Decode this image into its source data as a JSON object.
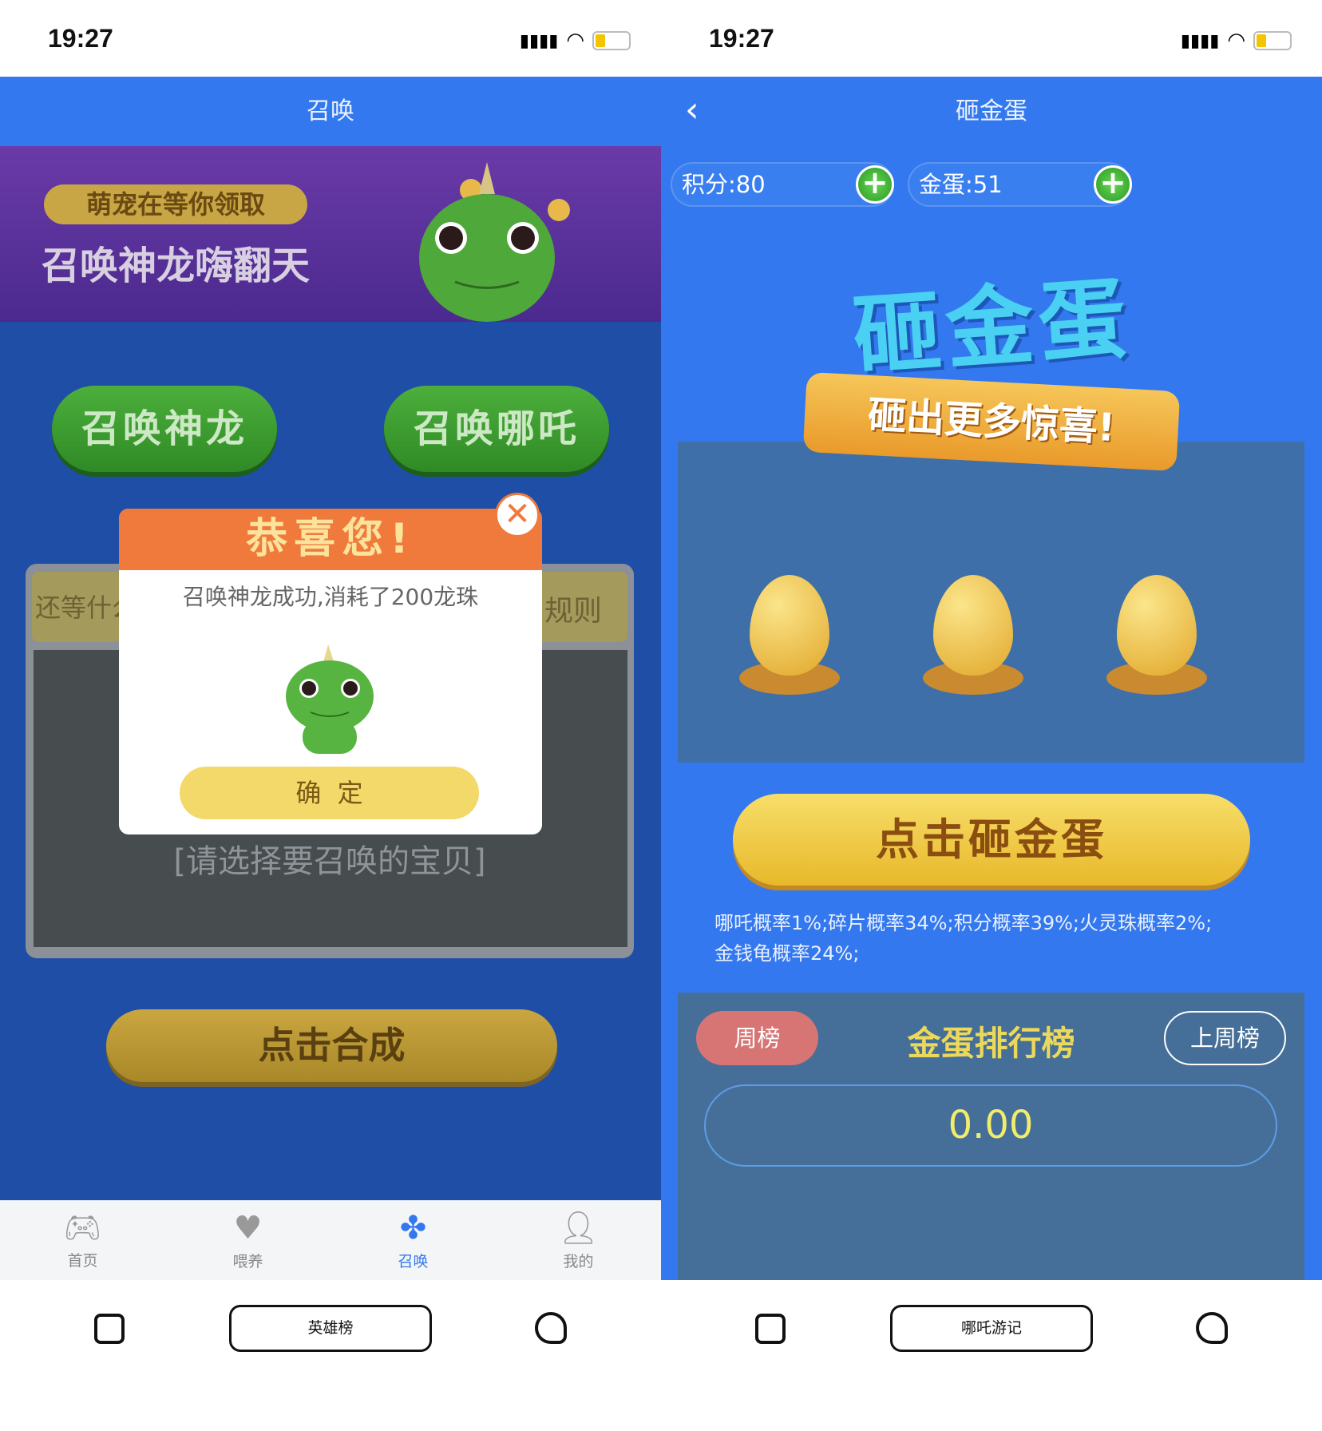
{
  "left": {
    "status": {
      "time": "19:27"
    },
    "header": {
      "title": "召唤"
    },
    "banner": {
      "tag": "萌宠在等你领取",
      "headline": "召唤神龙嗨翻天"
    },
    "buttons": {
      "summon_dragon": "召唤神龙",
      "summon_nezha": "召唤哪吒",
      "combine": "点击合成"
    },
    "panel": {
      "left_label": "还等什么",
      "right_label": "规则",
      "placeholder": "[请选择要召唤的宝贝]"
    },
    "modal": {
      "title": "恭喜您!",
      "message": "召唤神龙成功,消耗了200龙珠",
      "confirm": "确  定"
    },
    "tabs": [
      {
        "label": "首页",
        "icon": "gamepad-icon"
      },
      {
        "label": "喂养",
        "icon": "heart-icon"
      },
      {
        "label": "召唤",
        "icon": "pinwheel-icon",
        "active": true
      },
      {
        "label": "我的",
        "icon": "user-icon"
      }
    ],
    "bottom_nav": {
      "label": "英雄榜"
    }
  },
  "right": {
    "status": {
      "time": "19:27"
    },
    "header": {
      "title": "砸金蛋"
    },
    "points": "积分:80",
    "eggs_count": "金蛋:51",
    "hero": {
      "title": "砸金蛋",
      "ribbon": "砸出更多惊喜!"
    },
    "smash_button": "点击砸金蛋",
    "probabilities": [
      "哪吒概率1%;碎片概率34%;积分概率39%;火灵珠概率2%;",
      "金钱龟概率24%;"
    ],
    "ranking": {
      "tab_week": "周榜",
      "title": "金蛋排行榜",
      "tab_last_week": "上周榜",
      "value": "0.00"
    },
    "bottom_nav": {
      "label": "哪吒游记"
    }
  },
  "colors": {
    "header_blue": "#3478ef",
    "left_body": "#1f4ea6",
    "right_body": "#3478ef",
    "modal_orange": "#ef7a3c",
    "accent_yellow": "#f2d65a",
    "active_tab": "#3478ef"
  }
}
